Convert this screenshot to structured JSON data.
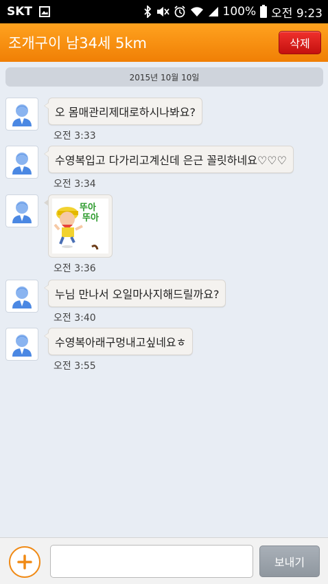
{
  "status_bar": {
    "carrier": "SKT",
    "battery": "100%",
    "time": "오전 9:23"
  },
  "header": {
    "title": "조개구이 남34세 5km",
    "delete_label": "삭제"
  },
  "date_separator": "2015년 10월 10일",
  "messages": [
    {
      "type": "text",
      "text": "오 몸매관리제대로하시나봐요?",
      "time": "오전 3:33"
    },
    {
      "type": "text",
      "text": "수영복입고 다가리고계신데 은근 꼴릿하네요♡♡♡",
      "time": "오전 3:34"
    },
    {
      "type": "sticker",
      "sticker_text": "뚜아\n뚜아",
      "time": "오전 3:36"
    },
    {
      "type": "text",
      "text": "누님 만나서 오일마사지해드릴까요?",
      "time": "오전 3:40"
    },
    {
      "type": "text",
      "text": "수영복아래구멍내고싶네요ㅎ",
      "time": "오전 3:55"
    }
  ],
  "input_bar": {
    "placeholder": "",
    "send_label": "보내기"
  },
  "colors": {
    "header_orange": "#f59211",
    "delete_red": "#d8201d",
    "background": "#e8edf4"
  }
}
